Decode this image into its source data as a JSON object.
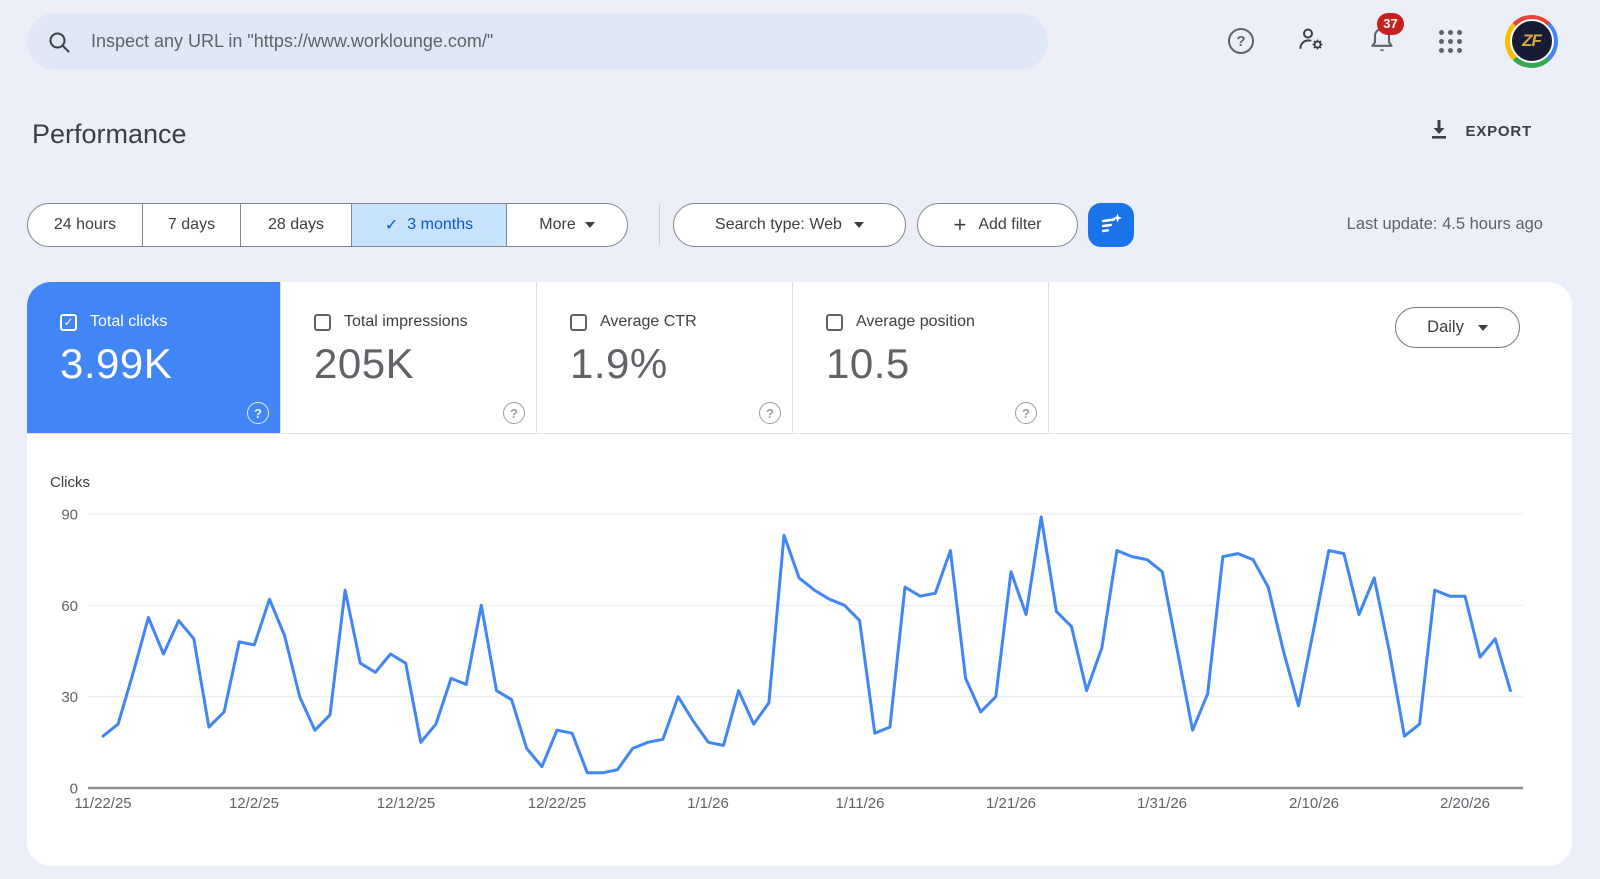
{
  "topbar": {
    "search_placeholder": "Inspect any URL in \"https://www.worklounge.com/\"",
    "notification_count": "37",
    "avatar_initials": "ZF"
  },
  "header": {
    "title": "Performance",
    "export_label": "EXPORT"
  },
  "controls": {
    "ranges": [
      "24 hours",
      "7 days",
      "28 days",
      "3 months"
    ],
    "selected_range": "3 months",
    "more_label": "More",
    "search_type_label": "Search type: Web",
    "add_filter_label": "Add filter",
    "last_update": "Last update: 4.5 hours ago"
  },
  "cards": [
    {
      "label": "Total clicks",
      "value": "3.99K",
      "selected": true
    },
    {
      "label": "Total impressions",
      "value": "205K",
      "selected": false
    },
    {
      "label": "Average CTR",
      "value": "1.9%",
      "selected": false
    },
    {
      "label": "Average position",
      "value": "10.5",
      "selected": false
    }
  ],
  "granularity": {
    "selected": "Daily"
  },
  "icons": {
    "check": "✓",
    "question": "?",
    "plus": "+"
  },
  "chart_data": {
    "type": "line",
    "title": "Clicks",
    "xlabel": "",
    "ylabel": "Clicks",
    "x_labels": [
      "11/22/25",
      "12/2/25",
      "12/12/25",
      "12/22/25",
      "1/1/26",
      "1/11/26",
      "1/21/26",
      "1/31/26",
      "2/10/26",
      "2/20/26"
    ],
    "x_tick_interval_days": 10,
    "yticks": [
      0,
      30,
      60,
      90
    ],
    "ylim": [
      0,
      90
    ],
    "grid": "horizontal-only",
    "legend": "none",
    "series": [
      {
        "name": "Total clicks",
        "color": "#4285f4",
        "unit": "clicks per day",
        "values": [
          17,
          21,
          38,
          56,
          44,
          55,
          49,
          20,
          25,
          48,
          47,
          62,
          50,
          30,
          19,
          24,
          65,
          41,
          38,
          44,
          41,
          15,
          21,
          36,
          34,
          60,
          32,
          29,
          13,
          7,
          19,
          18,
          5,
          5,
          6,
          13,
          15,
          16,
          30,
          22,
          15,
          14,
          32,
          21,
          28,
          83,
          69,
          65,
          62,
          60,
          55,
          18,
          20,
          66,
          63,
          64,
          78,
          36,
          25,
          30,
          71,
          57,
          89,
          58,
          53,
          32,
          46,
          78,
          76,
          75,
          71,
          45,
          19,
          31,
          76,
          77,
          75,
          66,
          45,
          27,
          52,
          78,
          77,
          57,
          69,
          45,
          17,
          21,
          65,
          63,
          63,
          43,
          49,
          32
        ]
      }
    ]
  }
}
